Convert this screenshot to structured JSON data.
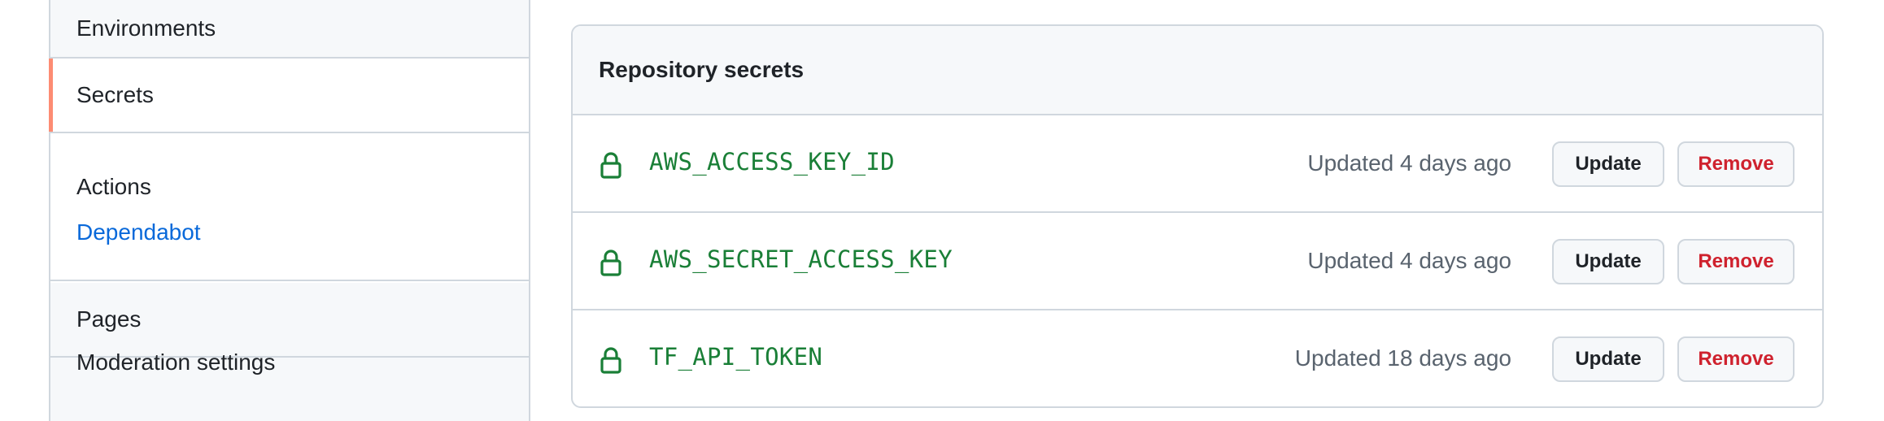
{
  "sidebar": {
    "environments": "Environments",
    "secrets": "Secrets",
    "actions_group": {
      "title": "Actions",
      "link": "Dependabot"
    },
    "pages": "Pages",
    "moderation": "Moderation settings",
    "active_color": "#fd8c73"
  },
  "panel": {
    "title": "Repository secrets",
    "secrets": [
      {
        "name": "AWS_ACCESS_KEY_ID",
        "updated": "Updated 4 days ago",
        "update_label": "Update",
        "remove_label": "Remove",
        "icon": "lock-icon"
      },
      {
        "name": "AWS_SECRET_ACCESS_KEY",
        "updated": "Updated 4 days ago",
        "update_label": "Update",
        "remove_label": "Remove",
        "icon": "lock-icon"
      },
      {
        "name": "TF_API_TOKEN",
        "updated": "Updated 18 days ago",
        "update_label": "Update",
        "remove_label": "Remove",
        "icon": "lock-icon"
      }
    ]
  },
  "colors": {
    "secret_name": "#1a7f37",
    "link": "#0969da",
    "danger": "#cf222e"
  }
}
